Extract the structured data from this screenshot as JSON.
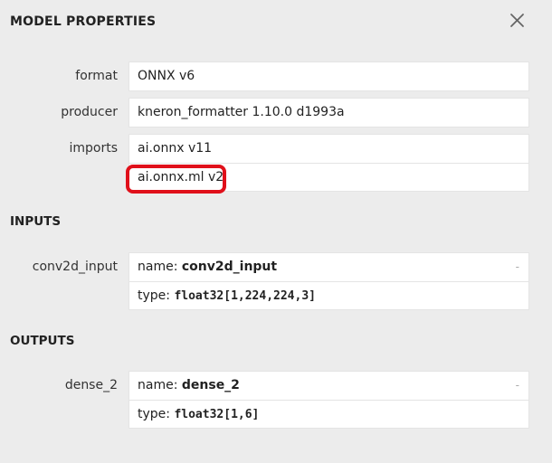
{
  "header": {
    "title": "MODEL PROPERTIES"
  },
  "properties": {
    "format": {
      "label": "format",
      "value": "ONNX v6"
    },
    "producer": {
      "label": "producer",
      "value": "kneron_formatter 1.10.0 d1993a"
    },
    "imports": {
      "label": "imports",
      "values": [
        "ai.onnx v11",
        "ai.onnx.ml v2"
      ]
    }
  },
  "inputs": {
    "title": "INPUTS",
    "items": [
      {
        "label": "conv2d_input",
        "name_prefix": "name: ",
        "name": "conv2d_input",
        "type_prefix": "type: ",
        "type": "float32[1,224,224,3]",
        "expander": "-"
      }
    ]
  },
  "outputs": {
    "title": "OUTPUTS",
    "items": [
      {
        "label": "dense_2",
        "name_prefix": "name: ",
        "name": "dense_2",
        "type_prefix": "type: ",
        "type": "float32[1,6]",
        "expander": "-"
      }
    ]
  },
  "colors": {
    "background": "#ececec",
    "box": "#ffffff",
    "annotation": "#e0101a"
  }
}
